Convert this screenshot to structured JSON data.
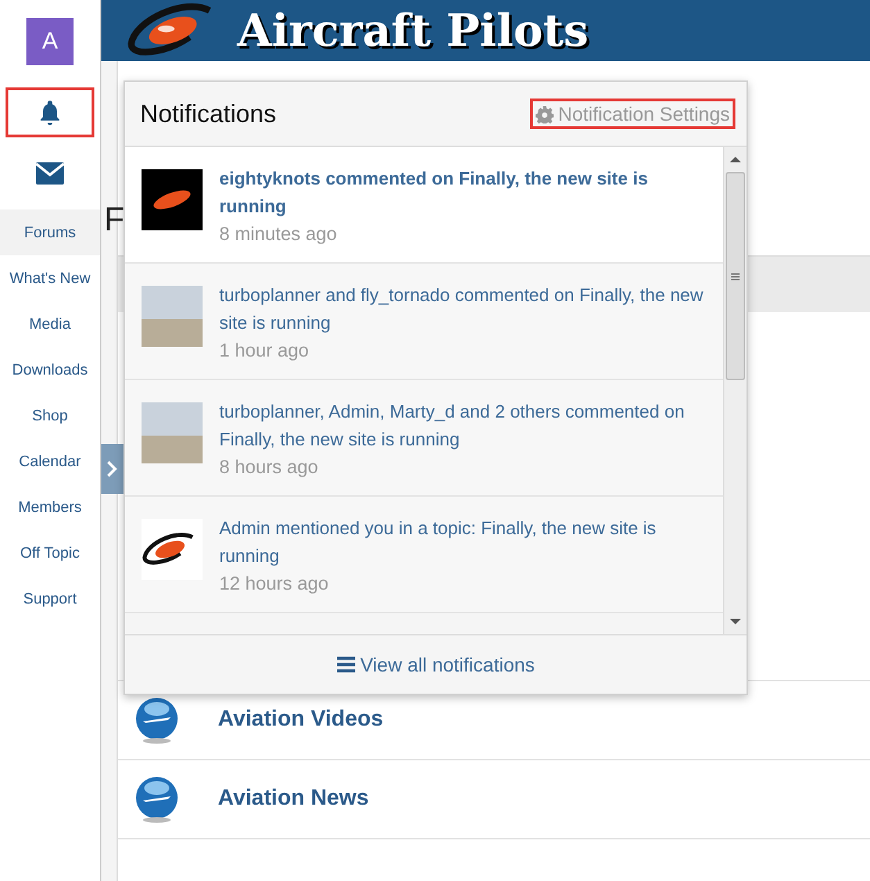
{
  "sidebar": {
    "avatar": {
      "letter": "A"
    },
    "icons": [
      {
        "kind": "bell",
        "highlighted": true
      },
      {
        "kind": "mail",
        "highlighted": false
      }
    ],
    "items": [
      {
        "label": "Forums",
        "selected": true
      },
      {
        "label": "What's New",
        "selected": false
      },
      {
        "label": "Media",
        "selected": false
      },
      {
        "label": "Downloads",
        "selected": false
      },
      {
        "label": "Shop",
        "selected": false
      },
      {
        "label": "Calendar",
        "selected": false
      },
      {
        "label": "Members",
        "selected": false
      },
      {
        "label": "Off Topic",
        "selected": false
      },
      {
        "label": "Support",
        "selected": false
      }
    ]
  },
  "header": {
    "title": "Aircraft Pilots"
  },
  "page": {
    "title": "F"
  },
  "forums": [
    {
      "title": "Aviation Videos"
    },
    {
      "title": "Aviation News"
    }
  ],
  "notifications": {
    "title": "Notifications",
    "settings": {
      "label": "Notification Settings",
      "highlighted": true
    },
    "items": [
      {
        "kind": "badge",
        "text": "eightyknots commented on Finally, the new site is running",
        "time": "8 minutes ago",
        "unread": true
      },
      {
        "kind": "photo",
        "text": "turboplanner and fly_tornado commented on Finally, the new site is running",
        "time": "1 hour ago",
        "unread": false
      },
      {
        "kind": "photo",
        "text": "turboplanner, Admin, Marty_d and 2 others commented on Finally, the new site is running",
        "time": "8 hours ago",
        "unread": false
      },
      {
        "kind": "logo",
        "text": "Admin mentioned you in a topic: Finally, the new site is running",
        "time": "12 hours ago",
        "unread": false
      }
    ],
    "footer": "View all notifications"
  }
}
